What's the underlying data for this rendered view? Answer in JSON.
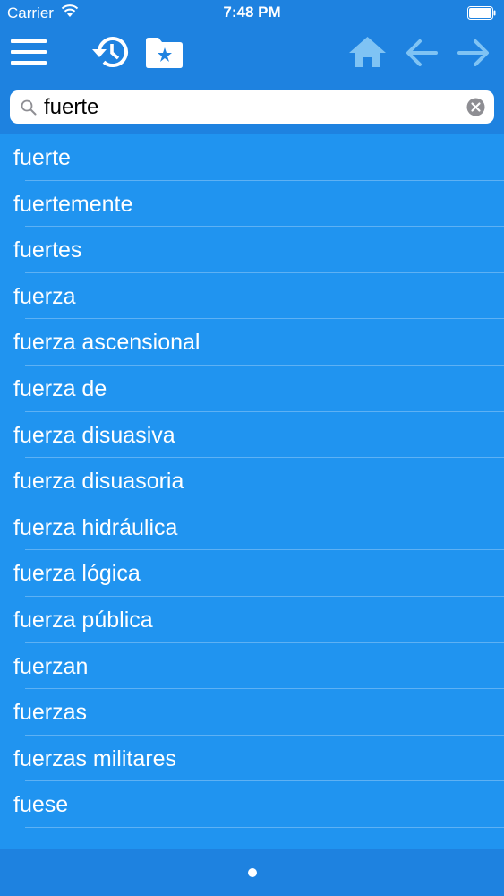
{
  "status_bar": {
    "carrier": "Carrier",
    "time": "7:48 PM"
  },
  "toolbar": {
    "icons": [
      "menu-icon",
      "history-icon",
      "favorites-folder-icon",
      "home-icon",
      "back-arrow-icon",
      "forward-arrow-icon"
    ]
  },
  "search": {
    "value": "fuerte",
    "placeholder": ""
  },
  "results": [
    "fuerte",
    "fuertemente",
    "fuertes",
    "fuerza",
    "fuerza ascensional",
    "fuerza de",
    "fuerza disuasiva",
    "fuerza disuasoria",
    "fuerza hidráulica",
    "fuerza lógica",
    "fuerza pública",
    "fuerzan",
    "fuerzas",
    "fuerzas militares",
    "fuese"
  ],
  "colors": {
    "bar_blue": "#1E82E0",
    "list_blue": "#2094F0",
    "disabled_icon": "#7FC3F4"
  }
}
